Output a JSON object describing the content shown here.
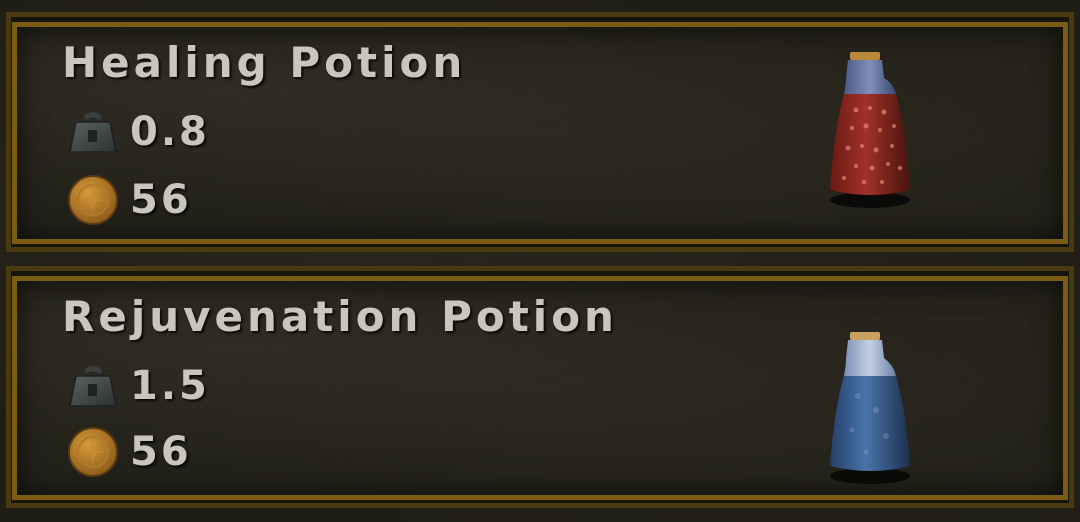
{
  "items": [
    {
      "name": "Healing Potion",
      "weight": "0.8",
      "value": "56",
      "potion_icon": "red-potion-icon",
      "potion_color": "#8a2a22"
    },
    {
      "name": "Rejuvenation Potion",
      "weight": "1.5",
      "value": "56",
      "potion_icon": "blue-potion-icon",
      "potion_color": "#3a5f8f"
    }
  ],
  "icons": {
    "weight": "weight-icon",
    "gold": "gold-coin-icon"
  },
  "colors": {
    "frame_gold": "#7a5c12",
    "text": "#c9c6bd",
    "background": "#23221a"
  }
}
